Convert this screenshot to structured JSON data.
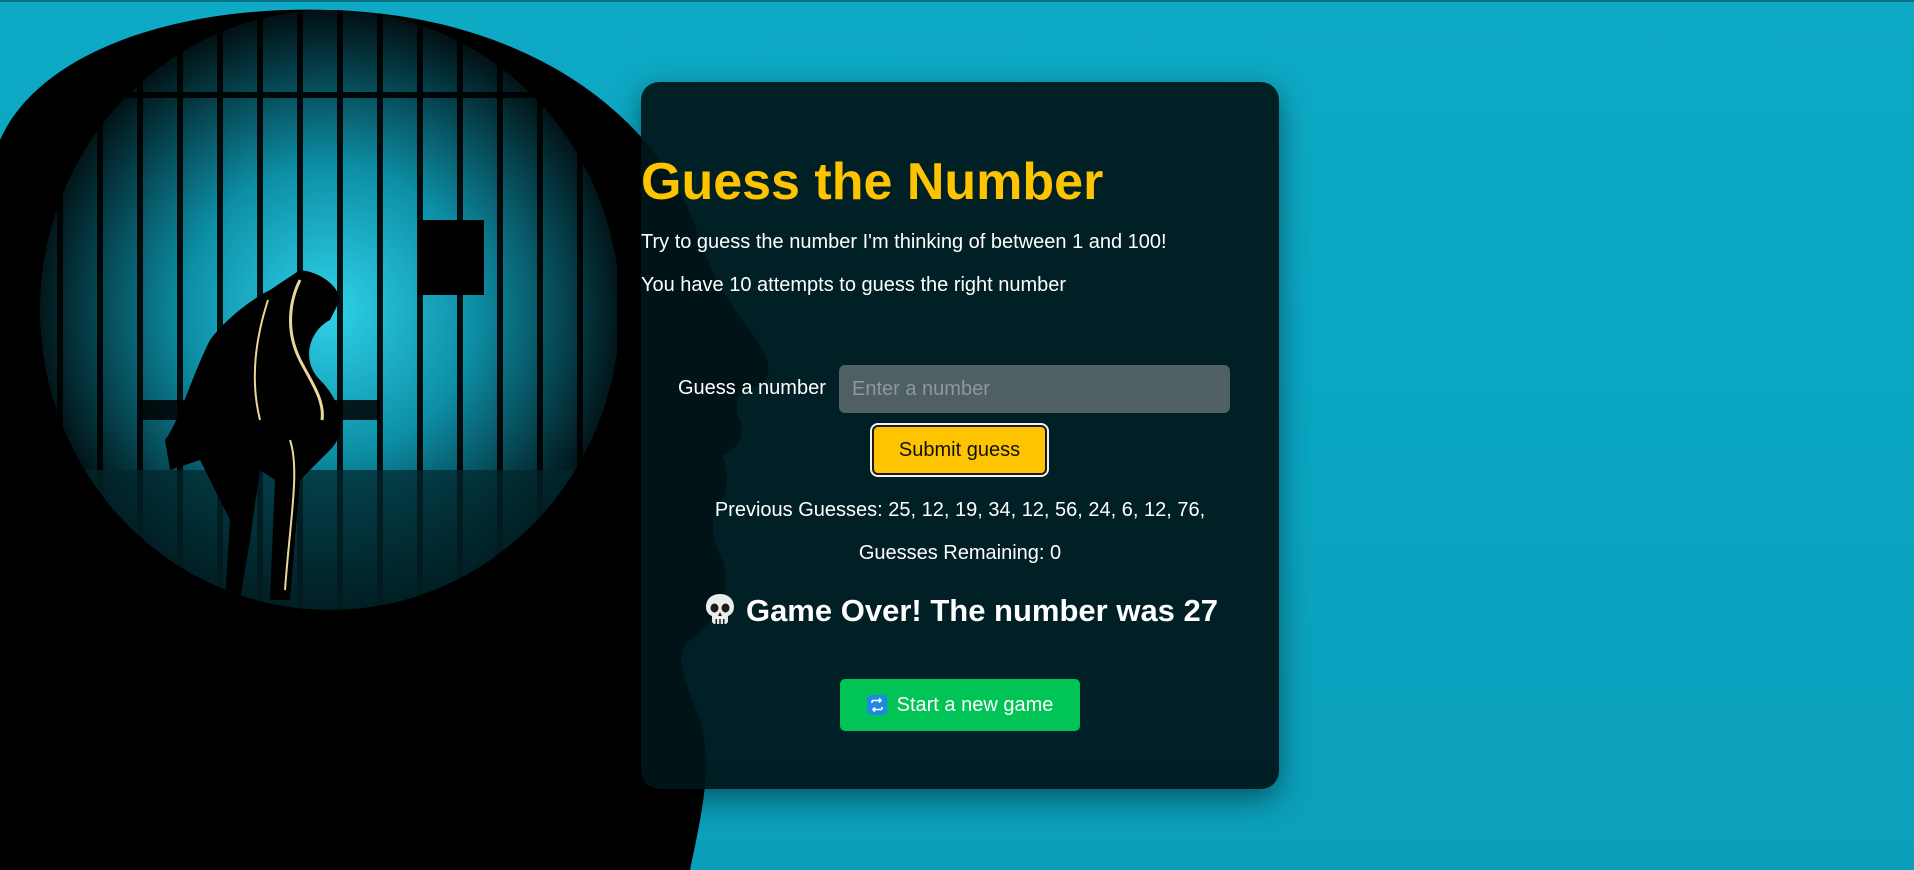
{
  "game": {
    "title": "Guess the Number",
    "instructions": "Try to guess the number I'm thinking of between 1 and 100!",
    "attempts_text": "You have 10 attempts to guess the right number",
    "input_label": "Guess a number",
    "input_placeholder": "Enter a number",
    "input_value": "",
    "submit_label": "Submit guess",
    "previous_guesses_label": "Previous Guesses:",
    "previous_guesses": "25, 12, 19, 34, 12, 56, 24, 6, 12, 76,",
    "remaining_label": "Guesses Remaining:",
    "remaining_value": "0",
    "result_icon": "skull-icon",
    "result_text": "Game Over! The number was 27",
    "new_game_icon": "repeat-icon",
    "new_game_label": "Start a new game"
  },
  "colors": {
    "accent": "#ffc400",
    "new_game_button": "#00c455",
    "page_background": "#0ea9c4",
    "card_background": "#00161a"
  },
  "background_image": "silhouette-head-with-prison-bars"
}
